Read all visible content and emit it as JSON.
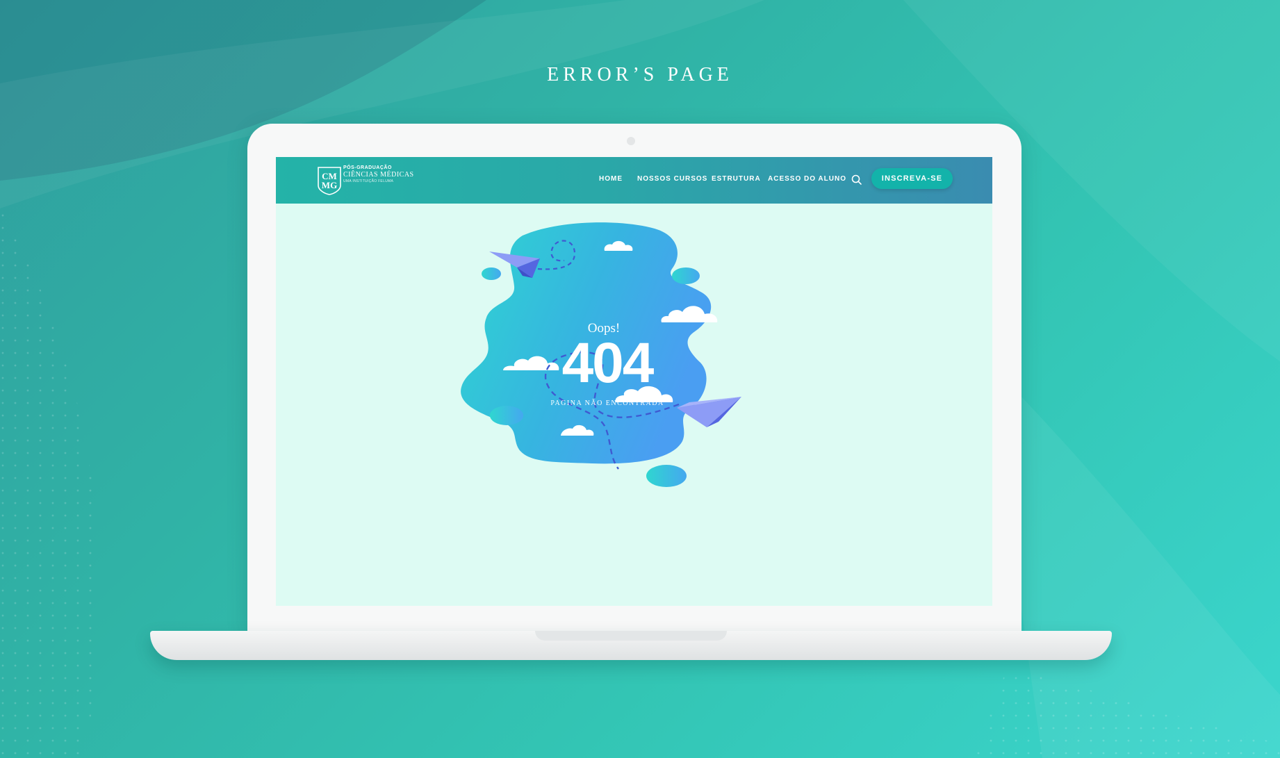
{
  "page": {
    "heading": "ERROR’S PAGE"
  },
  "site": {
    "logo": {
      "monogram": "CMMG",
      "line1": "PÓS-GRADUAÇÃO",
      "line2": "CIÊNCIAS MÉDICAS",
      "line3": "UMA INSTITUIÇÃO FELUMA"
    },
    "nav": [
      {
        "label": "HOME"
      },
      {
        "label": "NOSSOS CURSOS"
      },
      {
        "label": "ESTRUTURA"
      },
      {
        "label": "ACESSO DO ALUNO"
      }
    ],
    "search_icon": "search-icon",
    "cta_label": "INSCREVA-SE"
  },
  "error": {
    "oops": "Oops!",
    "code": "404",
    "message": "PAGINA NÃO ENCONTRADA"
  },
  "colors": {
    "background": "#33c5b4",
    "navbar_start": "#24b3a8",
    "navbar_end": "#3a8cb0",
    "screen_bg": "#ddfbf3",
    "cta": "#13b3aa",
    "blob_start": "#2fd6d0",
    "blob_end": "#4aa0f0",
    "plane": "#6f7cf0"
  }
}
